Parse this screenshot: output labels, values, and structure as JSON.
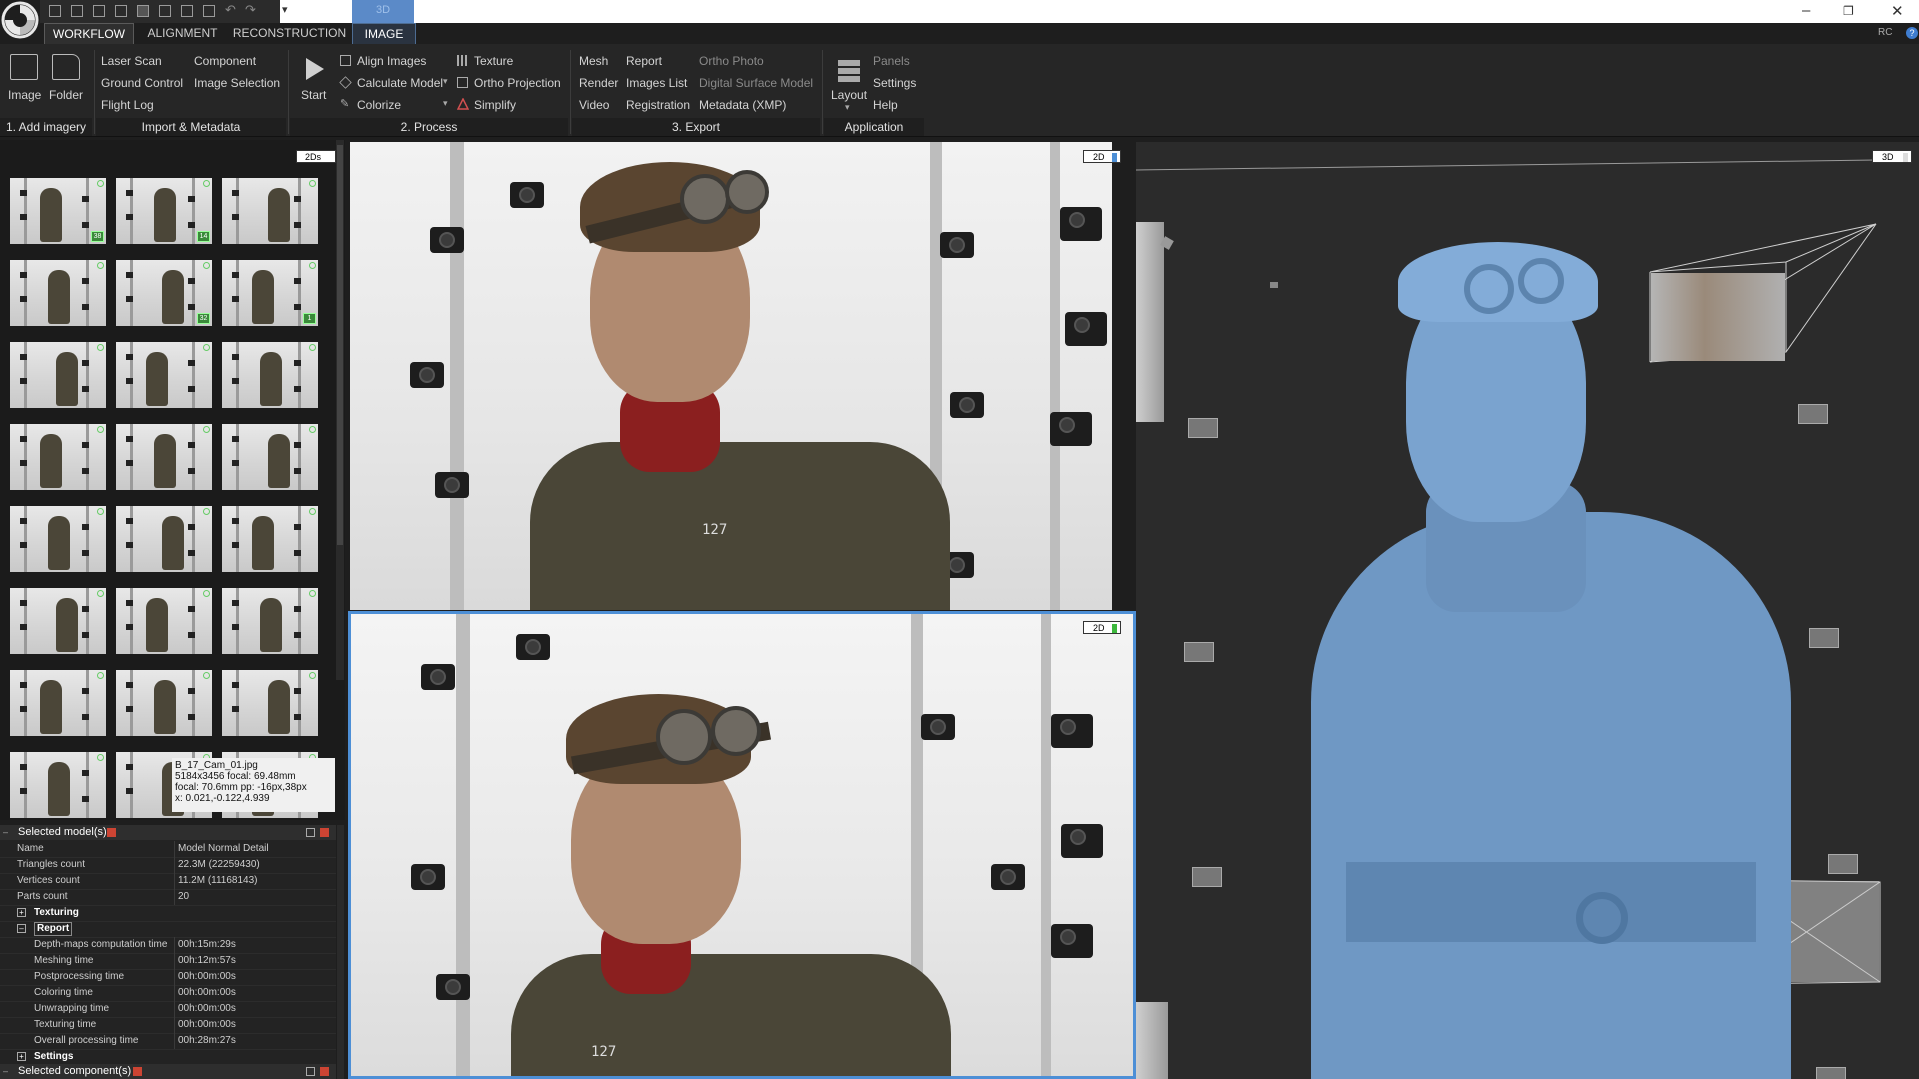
{
  "titlebar": {
    "tab_3d": "3D",
    "minimize": "–",
    "restore": "❐",
    "close": "✕",
    "rc": "RC",
    "help": "?"
  },
  "tabs": [
    "WORKFLOW",
    "ALIGNMENT",
    "RECONSTRUCTION",
    "IMAGE"
  ],
  "ribbon": {
    "add_imagery": {
      "image": "Image",
      "folder": "Folder",
      "group": "1. Add imagery"
    },
    "import_metadata": {
      "items": [
        "Laser Scan",
        "Component",
        "Ground Control",
        "Image Selection",
        "Flight Log"
      ],
      "group": "Import & Metadata"
    },
    "process": {
      "start": "Start",
      "items": [
        "Align Images",
        "Texture",
        "Calculate Model",
        "Ortho Projection",
        "Colorize",
        "Simplify"
      ],
      "group": "2. Process"
    },
    "export": {
      "items": [
        "Mesh",
        "Report",
        "Ortho Photo",
        "Render",
        "Images List",
        "Digital Surface Model",
        "Video",
        "Registration",
        "Metadata (XMP)"
      ],
      "group": "3. Export"
    },
    "application": {
      "layout": "Layout",
      "items": [
        "Panels",
        "Settings",
        "Help"
      ],
      "group": "Application"
    }
  },
  "thumbs": {
    "panel_tag": "2Ds",
    "badge_labels": [
      "38",
      "14",
      "",
      "",
      "32",
      "1"
    ],
    "tooltip": {
      "line1": "B_17_Cam_01.jpg",
      "line2": "5184x3456   focal: 69.48mm",
      "line3": "focal: 70.6mm  pp: -16px,38px",
      "line4": "  x: 0.021,-0.122,4.939"
    }
  },
  "props": {
    "header": "Selected model(s)",
    "rows": [
      {
        "k": "Name",
        "v": "Model Normal Detail"
      },
      {
        "k": "Triangles count",
        "v": "22.3M (22259430)"
      },
      {
        "k": "Vertices count",
        "v": "11.2M (11168143)"
      },
      {
        "k": "Parts count",
        "v": "20"
      }
    ],
    "texturing": "Texturing",
    "report": "Report",
    "report_rows": [
      {
        "k": "Depth-maps computation time",
        "v": "00h:15m:29s"
      },
      {
        "k": "Meshing time",
        "v": "00h:12m:57s"
      },
      {
        "k": "Postprocessing time",
        "v": "00h:00m:00s"
      },
      {
        "k": "Coloring time",
        "v": "00h:00m:00s"
      },
      {
        "k": "Unwrapping time",
        "v": "00h:00m:00s"
      },
      {
        "k": "Texturing time",
        "v": "00h:00m:00s"
      },
      {
        "k": "Overall processing time",
        "v": "00h:28m:27s"
      }
    ],
    "settings": "Settings",
    "component_header": "Selected component(s)"
  },
  "viewports": {
    "top_tag": "2D",
    "bottom_tag": "2D",
    "right_tag": "3D",
    "top_number": "127",
    "bottom_number": "127"
  },
  "colors": {
    "accent": "#4d8fd6",
    "model": "#6f98c4",
    "background": "#1e1e1e"
  }
}
